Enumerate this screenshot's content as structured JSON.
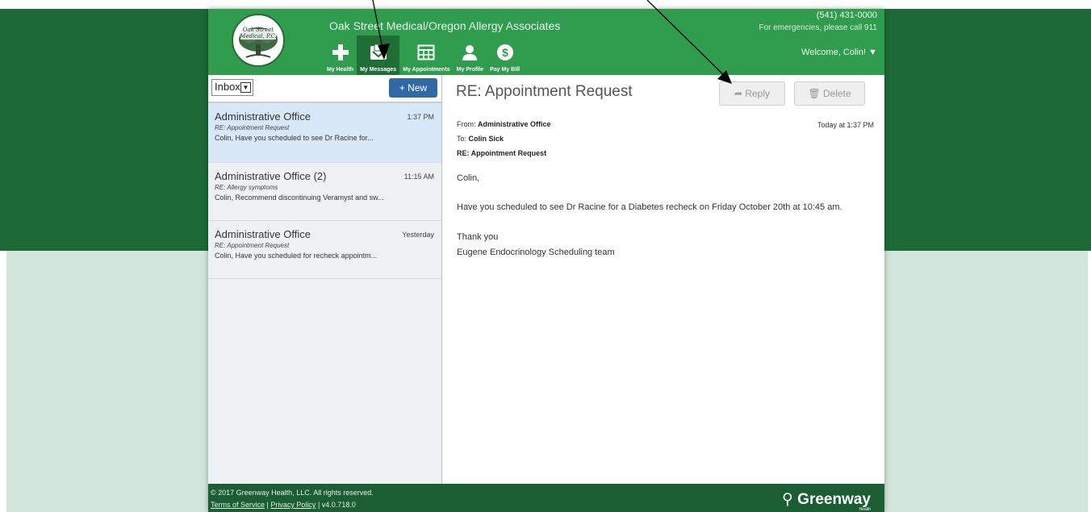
{
  "header": {
    "logo_text": "Oak Street Medical, P.C.",
    "practice_name": "Oak Street Medical/Oregon Allergy Associates",
    "phone": "(541) 431-0000",
    "emergency": "For emergencies, please call 911",
    "welcome": "Welcome, Colin! ▼"
  },
  "nav": {
    "items": [
      {
        "label": "My Health",
        "icon": "plus-icon"
      },
      {
        "label": "My Messages",
        "icon": "envelope-icon"
      },
      {
        "label": "My Appointments",
        "icon": "calendar-icon"
      },
      {
        "label": "My Profile",
        "icon": "person-icon"
      },
      {
        "label": "Pay My Bill",
        "icon": "dollar-icon"
      }
    ],
    "active": "My Messages"
  },
  "inbox": {
    "folder": "Inbox",
    "new_label": "+ New",
    "messages": [
      {
        "sender": "Administrative Office",
        "time": "1:37 PM",
        "subject": "RE: Appointment Request",
        "preview": "Colin, Have you scheduled to see Dr Racine for..."
      },
      {
        "sender": "Administrative Office (2)",
        "time": "11:15 AM",
        "subject": "RE: Allergy symptoms",
        "preview": "Colin, Recommend discontinuing Veramyst and sw..."
      },
      {
        "sender": "Administrative Office",
        "time": "Yesterday",
        "subject": "RE: Appointment Request",
        "preview": "Colin, Have you scheduled for recheck appointm..."
      }
    ]
  },
  "message": {
    "title": "RE: Appointment Request",
    "reply_label": "Reply",
    "delete_label": "Delete",
    "from_label": "From:",
    "from": "Administrative Office",
    "to_label": "To:",
    "to": "Colin Sick",
    "subject": "RE: Appointment Request",
    "date": "Today at 1:37 PM",
    "greeting": "Colin,",
    "body": "Have you scheduled to see Dr Racine for a Diabetes recheck on Friday October 20th at 10:45 am.",
    "closing": "Thank you",
    "signature": "Eugene Endocrinology Scheduling team"
  },
  "footer": {
    "copyright": "© 2017 Greenway Health, LLC. All rights reserved.",
    "terms": "Terms of Service",
    "separator": "|",
    "privacy": "Privacy Policy",
    "version": "v4.0.718.0",
    "brand": "Greenway",
    "brand_sub": "Health"
  },
  "colors": {
    "header_green": "#2f9c4e",
    "dark_green": "#1b6a38",
    "new_button_blue": "#2f6aa6",
    "selected_row": "#d9e8f8"
  }
}
